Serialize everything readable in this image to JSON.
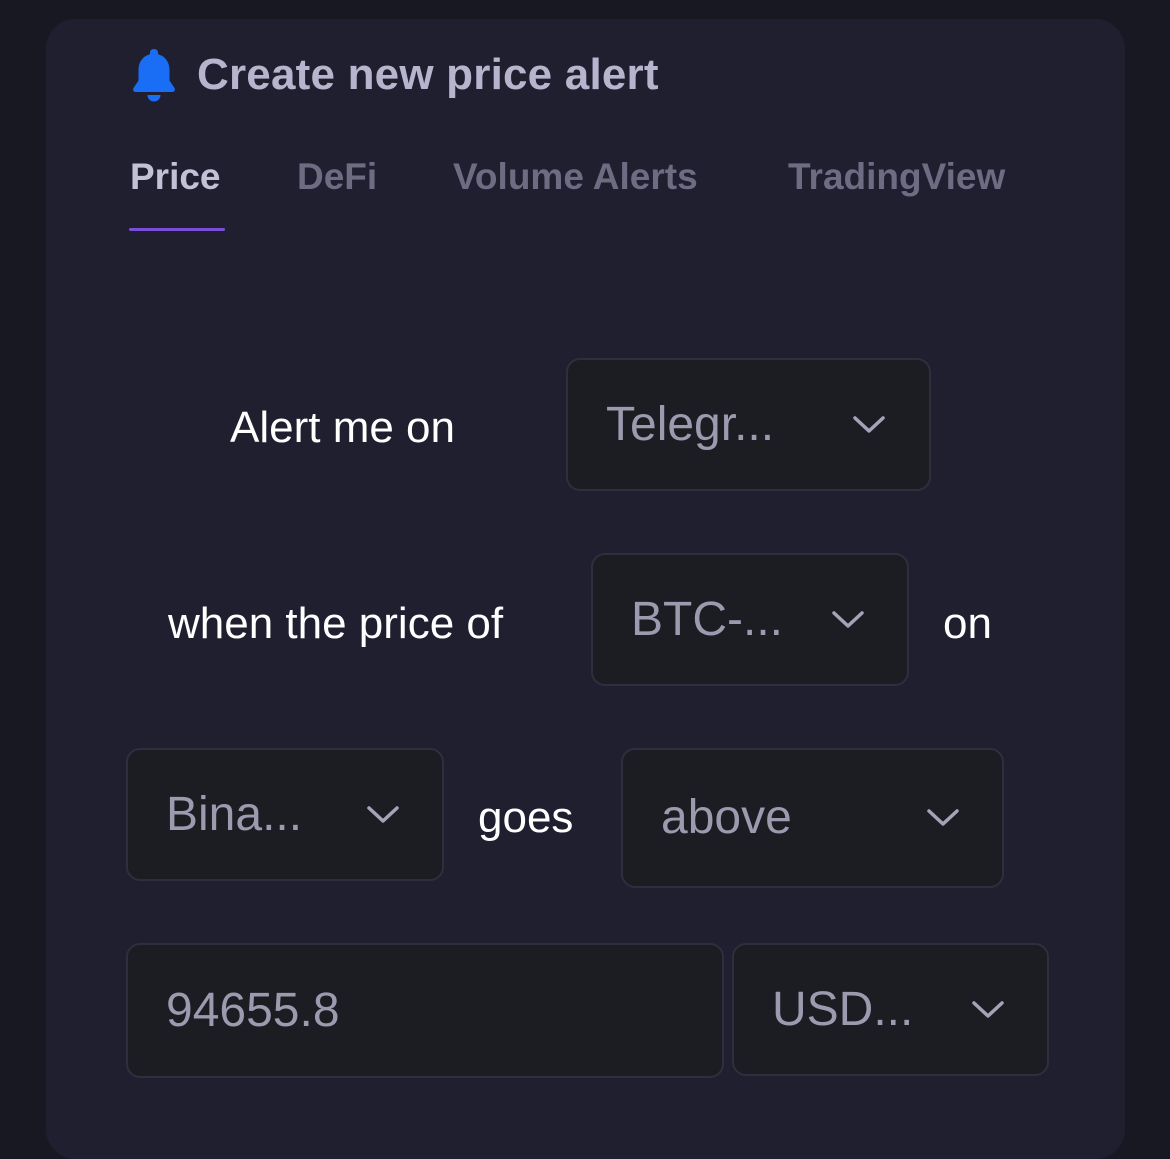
{
  "header": {
    "title": "Create new price alert",
    "icon": "bell-icon",
    "icon_color": "#1a6ef5"
  },
  "tabs": [
    {
      "label": "Price",
      "active": true
    },
    {
      "label": "DeFi",
      "active": false
    },
    {
      "label": "Volume Alerts",
      "active": false
    },
    {
      "label": "TradingView",
      "active": false
    }
  ],
  "form": {
    "alert_me_on_label": "Alert me on",
    "channel_select": {
      "value": "Telegr..."
    },
    "when_price_of_label": "when the price of",
    "pair_select": {
      "value": "BTC-..."
    },
    "on_label": "on",
    "exchange_select": {
      "value": "Bina..."
    },
    "goes_label": "goes",
    "direction_select": {
      "value": "above"
    },
    "price_input": {
      "value": "94655.8"
    },
    "currency_select": {
      "value": "USD..."
    }
  },
  "colors": {
    "accent_underline": "#7c4ddb",
    "background": "#181823",
    "panel": "#201f30"
  }
}
